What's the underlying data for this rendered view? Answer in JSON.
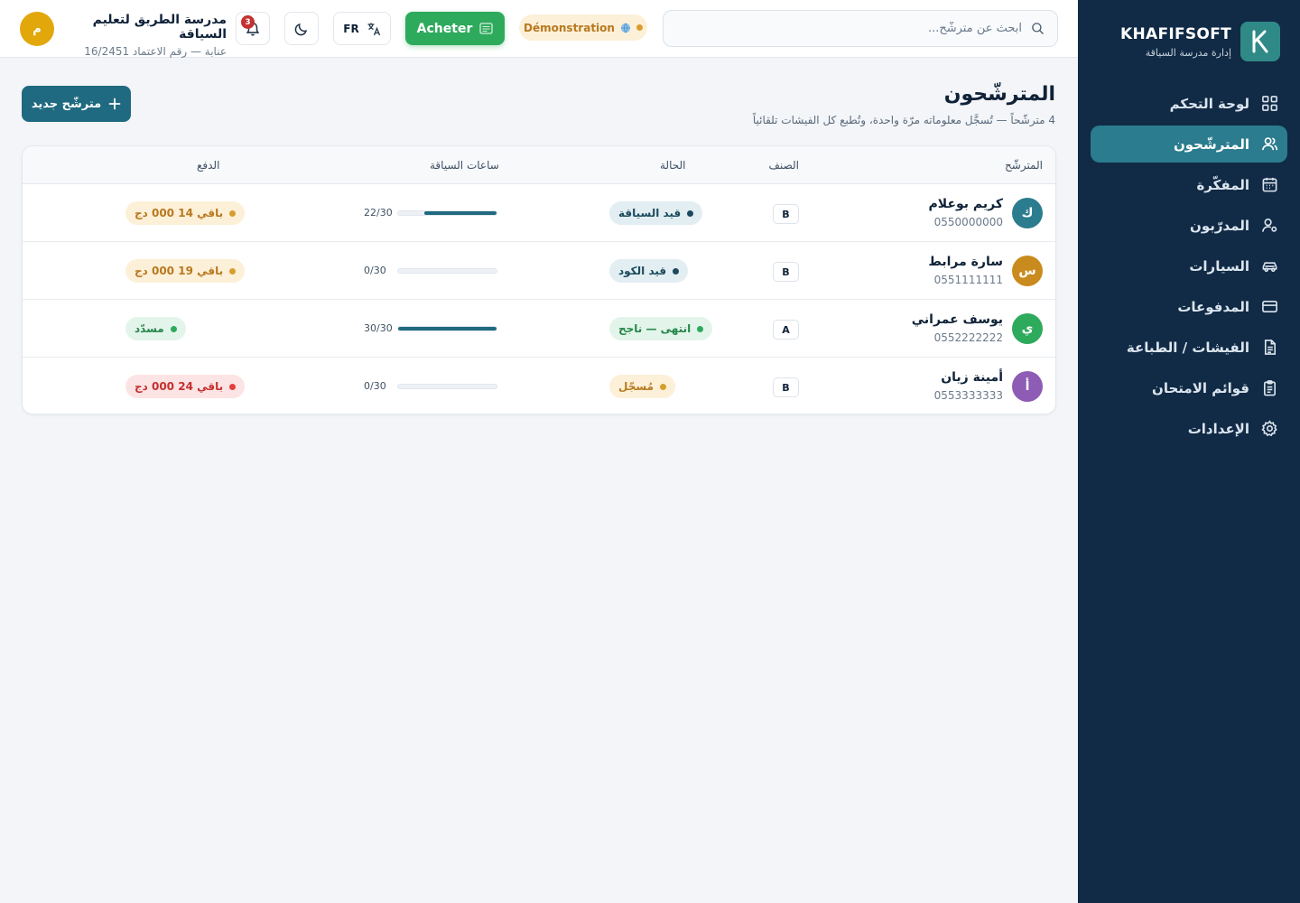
{
  "brand": {
    "name": "KHAFIFSOFT",
    "subtitle": "إدارة مدرسة السياقة",
    "logo_letter": "K"
  },
  "sidebar": {
    "items": [
      {
        "label": "لوحة التحكم",
        "icon": "dashboard-icon",
        "active": false
      },
      {
        "label": "المترشّحون",
        "icon": "users-icon",
        "active": true
      },
      {
        "label": "المفكّرة",
        "icon": "calendar-icon",
        "active": false
      },
      {
        "label": "المدرّبون",
        "icon": "instructor-icon",
        "active": false
      },
      {
        "label": "السيارات",
        "icon": "car-icon",
        "active": false
      },
      {
        "label": "المدفوعات",
        "icon": "card-icon",
        "active": false
      },
      {
        "label": "الفيشات / الطباعة",
        "icon": "document-icon",
        "active": false
      },
      {
        "label": "قوائم الامتحان",
        "icon": "clipboard-icon",
        "active": false
      },
      {
        "label": "الإعدادات",
        "icon": "gear-icon",
        "active": false
      }
    ]
  },
  "header": {
    "search_placeholder": "ابحث عن مترشّح...",
    "demo_label": "Démonstration",
    "buy_label": "Acheter",
    "lang_label": "FR",
    "notification_count": "3",
    "school_name": "مدرسة الطريق لتعليم السياقة",
    "school_sub": "عنابة — رقم الاعتماد 16/2451",
    "user_initial": "م"
  },
  "page": {
    "title": "المترشّحون",
    "subtitle": "4 مترشّحاً — تُسجَّل معلوماته مرّة واحدة، وتُطبع كل الفيشات تلقائياً",
    "add_button": "مترشّح جديد"
  },
  "table": {
    "headers": {
      "candidate": "المترشّح",
      "class": "الصنف",
      "status": "الحالة",
      "hours": "ساعات السياقة",
      "payment": "الدفع"
    },
    "rows": [
      {
        "initial": "ك",
        "avatar_color": "#2b7c8e",
        "name": "كريم بوعلام",
        "phone": "0550000000",
        "class": "B",
        "status": "قيد السياقة",
        "status_bg": "#e3eef2",
        "status_color": "#1a4a5c",
        "status_dot": "#1a4a5c",
        "hours": "22/30",
        "hours_fraction": 0.733,
        "payment": "باقي 14 000 دج",
        "pay_bg": "#fdf0d8",
        "pay_color": "#b7791f",
        "pay_dot": "#d69e2e"
      },
      {
        "initial": "س",
        "avatar_color": "#c98b1d",
        "name": "سارة مرابط",
        "phone": "0551111111",
        "class": "B",
        "status": "قيد الكود",
        "status_bg": "#e3eef2",
        "status_color": "#1a4a5c",
        "status_dot": "#1a4a5c",
        "hours": "0/30",
        "hours_fraction": 0,
        "payment": "باقي 19 000 دج",
        "pay_bg": "#fdf0d8",
        "pay_color": "#b7791f",
        "pay_dot": "#d69e2e"
      },
      {
        "initial": "ي",
        "avatar_color": "#2eaa5c",
        "name": "يوسف عمراني",
        "phone": "0552222222",
        "class": "A",
        "status": "انتهى — ناجح",
        "status_bg": "#e3f5ea",
        "status_color": "#25864a",
        "status_dot": "#2eaa5c",
        "hours": "30/30",
        "hours_fraction": 1,
        "payment": "مسدّد",
        "pay_bg": "#e3f5ea",
        "pay_color": "#25864a",
        "pay_dot": "#2eaa5c"
      },
      {
        "initial": "أ",
        "avatar_color": "#8e5bb5",
        "name": "أمينة زيان",
        "phone": "0553333333",
        "class": "B",
        "status": "مُسجّل",
        "status_bg": "#fdf0d8",
        "status_color": "#b7791f",
        "status_dot": "#d69e2e",
        "hours": "0/30",
        "hours_fraction": 0,
        "payment": "باقي 24 000 دج",
        "pay_bg": "#fde4e4",
        "pay_color": "#c53030",
        "pay_dot": "#e53e3e"
      }
    ]
  }
}
